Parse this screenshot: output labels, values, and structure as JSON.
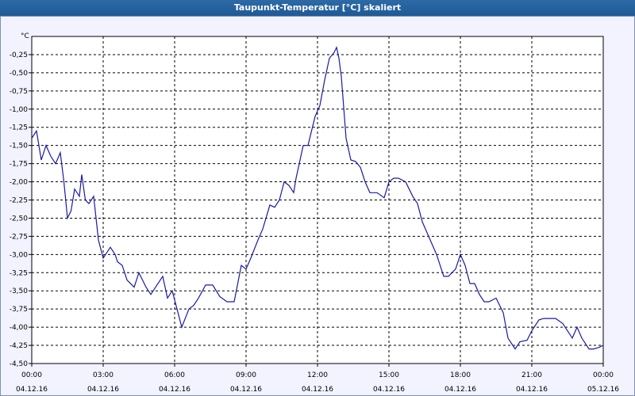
{
  "window": {
    "title": "Taupunkt-Temperatur [°C] skaliert"
  },
  "colors": {
    "line": "#1a1aa6",
    "grid": "#000000",
    "plot_bg": "#ffffff",
    "page_bg": "#f2f3ff"
  },
  "chart_data": {
    "type": "line",
    "title": "Taupunkt-Temperatur [°C] skaliert",
    "ylabel": "°C",
    "ylim": [
      -4.5,
      0.0
    ],
    "yticks": [
      -0.25,
      -0.5,
      -0.75,
      -1.0,
      -1.25,
      -1.5,
      -1.75,
      -2.0,
      -2.25,
      -2.5,
      -2.75,
      -3.0,
      -3.25,
      -3.5,
      -3.75,
      -4.0,
      -4.25,
      -4.5
    ],
    "ytick_labels": [
      "-0,25",
      "-0,50",
      "-0,75",
      "-1,00",
      "-1,25",
      "-1,50",
      "-1,75",
      "-2,00",
      "-2,25",
      "-2,50",
      "-2,75",
      "-3,00",
      "-3,25",
      "-3,50",
      "-3,75",
      "-4,00",
      "-4,25",
      "-4,50"
    ],
    "xlim_hours": [
      0,
      24
    ],
    "xticks": [
      {
        "time": "00:00",
        "date": "04.12.16"
      },
      {
        "time": "03:00",
        "date": "04.12.16"
      },
      {
        "time": "06:00",
        "date": "04.12.16"
      },
      {
        "time": "09:00",
        "date": "04.12.16"
      },
      {
        "time": "12:00",
        "date": "04.12.16"
      },
      {
        "time": "15:00",
        "date": "04.12.16"
      },
      {
        "time": "18:00",
        "date": "04.12.16"
      },
      {
        "time": "21:00",
        "date": "04.12.16"
      },
      {
        "time": "00:00",
        "date": "05.12.16"
      }
    ],
    "grid": true,
    "series": [
      {
        "x": [
          0.0,
          0.2,
          0.4,
          0.6,
          0.8,
          1.0,
          1.2,
          1.35,
          1.5,
          1.65,
          1.8,
          2.0,
          2.1,
          2.25,
          2.4,
          2.6,
          2.8,
          3.0,
          3.1,
          3.3,
          3.5,
          3.6,
          3.8,
          4.0,
          4.3,
          4.5,
          4.8,
          5.0,
          5.2,
          5.5,
          5.7,
          5.9,
          6.1,
          6.3,
          6.6,
          6.8,
          7.0,
          7.3,
          7.6,
          7.9,
          8.2,
          8.5,
          8.8,
          9.0,
          9.2,
          9.5,
          9.7,
          10.0,
          10.2,
          10.4,
          10.6,
          10.8,
          11.0,
          11.1,
          11.4,
          11.6,
          11.9,
          12.1,
          12.3,
          12.5,
          12.7,
          12.8,
          12.9,
          13.0,
          13.2,
          13.4,
          13.6,
          13.8,
          14.0,
          14.2,
          14.5,
          14.8,
          15.0,
          15.2,
          15.4,
          15.7,
          16.0,
          16.2,
          16.4,
          16.6,
          16.8,
          17.0,
          17.3,
          17.5,
          17.8,
          18.0,
          18.2,
          18.4,
          18.6,
          18.8,
          19.0,
          19.2,
          19.5,
          19.8,
          20.0,
          20.3,
          20.5,
          20.8,
          21.0,
          21.3,
          21.5,
          21.7,
          22.0,
          22.3,
          22.5,
          22.7,
          22.9,
          23.1,
          23.4,
          23.6,
          23.8,
          24.0
        ],
        "y": [
          -1.4,
          -1.3,
          -1.7,
          -1.5,
          -1.65,
          -1.75,
          -1.6,
          -2.0,
          -2.5,
          -2.4,
          -2.1,
          -2.2,
          -1.9,
          -2.25,
          -2.3,
          -2.2,
          -2.8,
          -3.05,
          -3.0,
          -2.9,
          -3.0,
          -3.1,
          -3.15,
          -3.35,
          -3.45,
          -3.25,
          -3.45,
          -3.55,
          -3.45,
          -3.3,
          -3.6,
          -3.5,
          -3.75,
          -4.0,
          -3.75,
          -3.7,
          -3.6,
          -3.42,
          -3.42,
          -3.58,
          -3.65,
          -3.65,
          -3.15,
          -3.2,
          -3.05,
          -2.8,
          -2.65,
          -2.32,
          -2.35,
          -2.25,
          -2.0,
          -2.05,
          -2.15,
          -1.95,
          -1.5,
          -1.5,
          -1.1,
          -0.95,
          -0.6,
          -0.3,
          -0.22,
          -0.15,
          -0.3,
          -0.55,
          -1.4,
          -1.7,
          -1.72,
          -1.8,
          -2.0,
          -2.15,
          -2.15,
          -2.22,
          -2.0,
          -1.95,
          -1.95,
          -2.0,
          -2.2,
          -2.3,
          -2.55,
          -2.7,
          -2.85,
          -3.0,
          -3.3,
          -3.3,
          -3.2,
          -3.0,
          -3.15,
          -3.4,
          -3.4,
          -3.55,
          -3.65,
          -3.65,
          -3.6,
          -3.8,
          -4.15,
          -4.3,
          -4.2,
          -4.18,
          -4.05,
          -3.9,
          -3.88,
          -3.88,
          -3.88,
          -3.95,
          -4.05,
          -4.15,
          -4.0,
          -4.15,
          -4.3,
          -4.3,
          -4.28,
          -4.25
        ]
      }
    ]
  }
}
